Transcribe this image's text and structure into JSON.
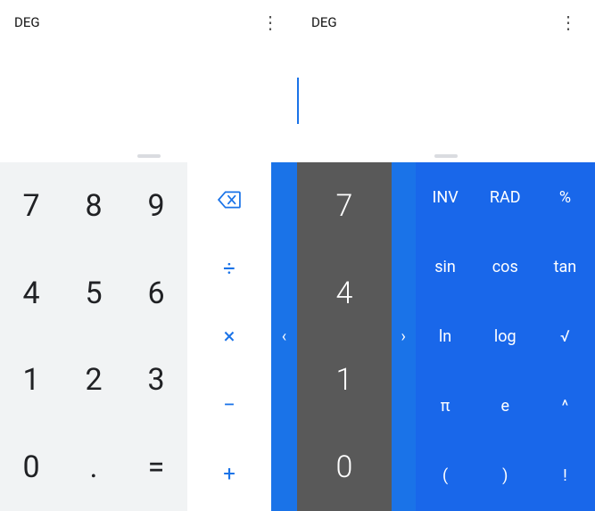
{
  "left": {
    "mode_label": "DEG",
    "menu_icon": "⋮",
    "numpad": [
      "7",
      "8",
      "9",
      "4",
      "5",
      "6",
      "1",
      "2",
      "3",
      "0",
      ".",
      "="
    ],
    "ops": {
      "backspace": "⌫",
      "divide": "÷",
      "multiply": "×",
      "minus": "−",
      "plus": "+"
    },
    "drawer_chevron": "‹"
  },
  "right": {
    "mode_label": "DEG",
    "menu_icon": "⋮",
    "numcol": [
      "7",
      "4",
      "1",
      "0"
    ],
    "drawer_chevron": "›",
    "sci": [
      "INV",
      "RAD",
      "%",
      "sin",
      "cos",
      "tan",
      "ln",
      "log",
      "√",
      "π",
      "e",
      "^",
      "(",
      ")",
      "!"
    ]
  },
  "colors": {
    "accent": "#1A73E8",
    "sci_bg": "#1967ea",
    "numcol_bg": "#595959",
    "numpad_bg": "#f1f3f4"
  }
}
